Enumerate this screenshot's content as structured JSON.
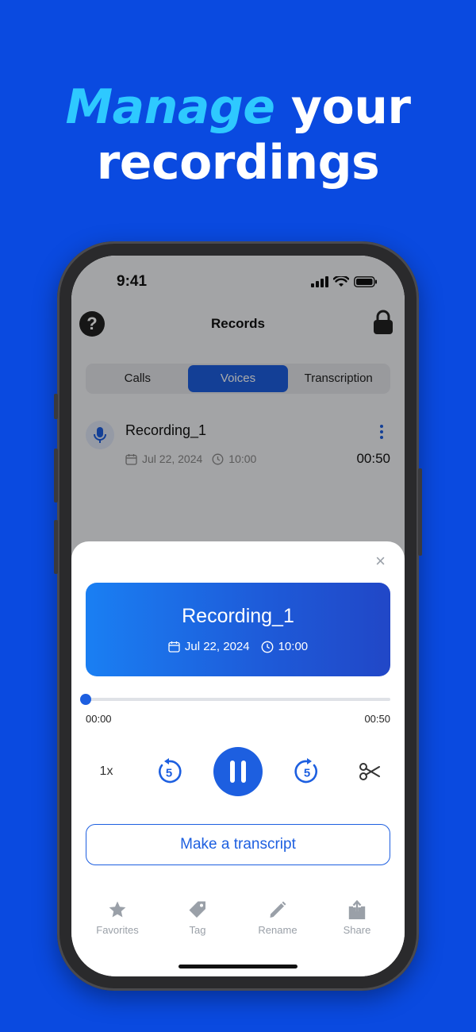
{
  "headline": {
    "accent": "Manage",
    "rest1": " your",
    "line2": "recordings"
  },
  "status_bar": {
    "time": "9:41"
  },
  "nav": {
    "title": "Records",
    "help_glyph": "?",
    "help_icon": "help-circle-icon",
    "lock_icon": "lock-icon"
  },
  "tabs": [
    {
      "label": "Calls",
      "active": false
    },
    {
      "label": "Voices",
      "active": true
    },
    {
      "label": "Transcription",
      "active": false
    }
  ],
  "recording_item": {
    "title": "Recording_1",
    "date": "Jul 22, 2024",
    "time": "10:00",
    "duration": "00:50"
  },
  "player": {
    "close_glyph": "×",
    "title": "Recording_1",
    "date": "Jul 22, 2024",
    "time": "10:00",
    "elapsed": "00:00",
    "total": "00:50",
    "progress": 0.0,
    "speed": "1x",
    "rewind_seconds": "5",
    "forward_seconds": "5",
    "transcript_label": "Make a transcript"
  },
  "actions": [
    {
      "label": "Favorites",
      "icon": "star-icon"
    },
    {
      "label": "Tag",
      "icon": "tag-icon"
    },
    {
      "label": "Rename",
      "icon": "pencil-icon"
    },
    {
      "label": "Share",
      "icon": "share-icon"
    }
  ],
  "colors": {
    "background": "#0a4ae0",
    "accent_text": "#2ec9ff",
    "primary": "#1d5fe0"
  }
}
